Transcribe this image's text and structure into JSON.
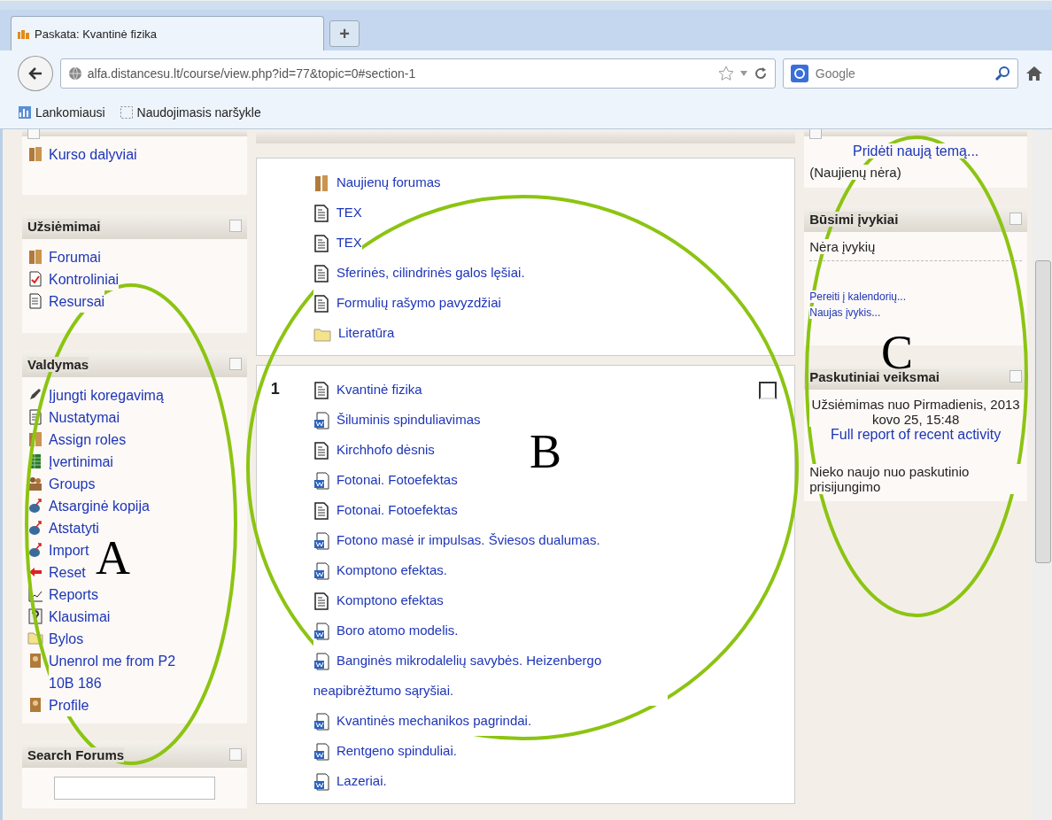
{
  "browser": {
    "tabs": [
      {
        "title": "Paskata: Kvantinė fizika",
        "selected": true
      }
    ],
    "new_tab": "+",
    "url": "alfa.distancesu.lt/course/view.php?id=77&topic=0#section-1",
    "search": {
      "placeholder": "Google"
    },
    "bookmarks": [
      {
        "label": "Lankomiausi",
        "kind": "most"
      },
      {
        "label": "Naudojimasis naršykle",
        "kind": "page"
      }
    ]
  },
  "left": [
    {
      "items": [
        {
          "label": "Kurso dalyviai",
          "kind": "people"
        }
      ]
    },
    {
      "title": "Užsiėmimai",
      "items": [
        {
          "label": "Forumai",
          "kind": "forum"
        },
        {
          "label": "Kontroliniai",
          "kind": "quiz"
        },
        {
          "label": "Resursai",
          "kind": "page"
        }
      ]
    },
    {
      "title": "Valdymas",
      "items": [
        {
          "label": "Įjungti koregavimą",
          "kind": "edit"
        },
        {
          "label": "Nustatymai",
          "kind": "settings"
        },
        {
          "label": "Assign roles",
          "kind": "people"
        },
        {
          "label": "Įvertinimai",
          "kind": "grades"
        },
        {
          "label": "Groups",
          "kind": "groups"
        },
        {
          "label": "Atsarginė kopija",
          "kind": "backup"
        },
        {
          "label": "Atstatyti",
          "kind": "backup"
        },
        {
          "label": "Import",
          "kind": "backup"
        },
        {
          "label": "Reset",
          "kind": "reset"
        },
        {
          "label": "Reports",
          "kind": "report"
        },
        {
          "label": "Klausimai",
          "kind": "question"
        },
        {
          "label": "Bylos",
          "kind": "folder"
        },
        {
          "label": "Unenrol me from P2 10B 186",
          "kind": "user"
        },
        {
          "label": "Profile",
          "kind": "user"
        }
      ]
    },
    {
      "title": "Search Forums",
      "search": true
    }
  ],
  "sections": [
    {
      "highlight": false,
      "items": [
        {
          "label": "Naujienų forumas",
          "kind": "forum"
        },
        {
          "label": "TEX",
          "kind": "page"
        },
        {
          "label": "TEX",
          "kind": "page"
        },
        {
          "label": "Sferinės, cilindrinės galos lęšiai.",
          "kind": "page"
        },
        {
          "label": "Formulių rašymo pavyzdžiai",
          "kind": "page"
        },
        {
          "label": "Literatūra",
          "kind": "folder"
        }
      ]
    },
    {
      "number": "1",
      "highlight": true,
      "items": [
        {
          "label": "Kvantinė fizika",
          "kind": "page"
        },
        {
          "label": "Šiluminis spinduliavimas",
          "kind": "doc"
        },
        {
          "label": "Kirchhofo dėsnis",
          "kind": "page"
        },
        {
          "label": "Fotonai. Fotoefektas",
          "kind": "doc"
        },
        {
          "label": "Fotonai. Fotoefektas",
          "kind": "page"
        },
        {
          "label": "Fotono masė ir impulsas. Šviesos dualumas.",
          "kind": "doc"
        },
        {
          "label": "Komptono efektas.",
          "kind": "doc"
        },
        {
          "label": "Komptono efektas",
          "kind": "page"
        },
        {
          "label": "Boro atomo modelis.",
          "kind": "doc"
        },
        {
          "label": "Banginės mikrodalelių savybės. Heizenbergo neapibrėžtumo sąryšiai.",
          "kind": "doc"
        },
        {
          "label": "Kvantinės mechanikos pagrindai.",
          "kind": "doc"
        },
        {
          "label": "Rentgeno spinduliai.",
          "kind": "doc"
        },
        {
          "label": "Lazeriai.",
          "kind": "doc"
        }
      ]
    }
  ],
  "right": {
    "add_topic": "Pridėti naują temą...",
    "no_news": "(Naujienų nėra)",
    "upcoming": {
      "title": "Būsimi įvykiai",
      "empty": "Nėra įvykių",
      "links": [
        "Pereiti į kalendorių...",
        "Naujas įvykis..."
      ]
    },
    "recent": {
      "title": "Paskutiniai veiksmai",
      "since": "Užsiėmimas nuo Pirmadienis, 2013 kovo 25, 15:48",
      "report": "Full report of recent activity",
      "nothing": "Nieko naujo nuo paskutinio prisijungimo"
    }
  },
  "annotations": [
    {
      "label": "A"
    },
    {
      "label": "B"
    },
    {
      "label": "C"
    }
  ]
}
